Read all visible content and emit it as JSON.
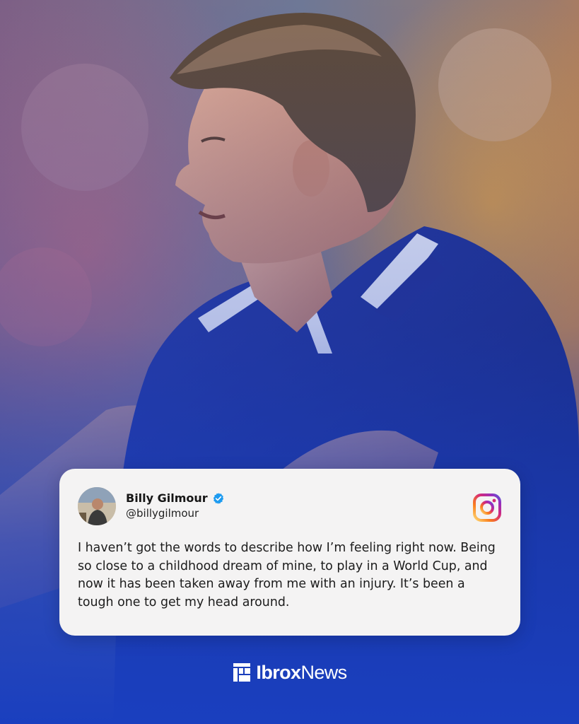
{
  "post": {
    "name": "Billy Gilmour",
    "handle": "@billygilmour",
    "text": "I haven’t got the words to describe how I’m feeling right now. Being so close to a childhood dream of mine, to play in a World Cup, and now it has been taken away from me with an injury. It’s been a tough one to get my head around.",
    "platform_icon": "instagram-icon",
    "verified_icon": "verified-badge-icon"
  },
  "brand": {
    "name_part1": "Ibrox",
    "name_part2": "News",
    "logo_icon": "ibrox-news-logo"
  },
  "colors": {
    "brand_blue": "#1a3fbf",
    "jersey_navy": "#1b2e8c",
    "card_bg": "#f4f3f3",
    "verified_blue": "#1d9bf0"
  }
}
